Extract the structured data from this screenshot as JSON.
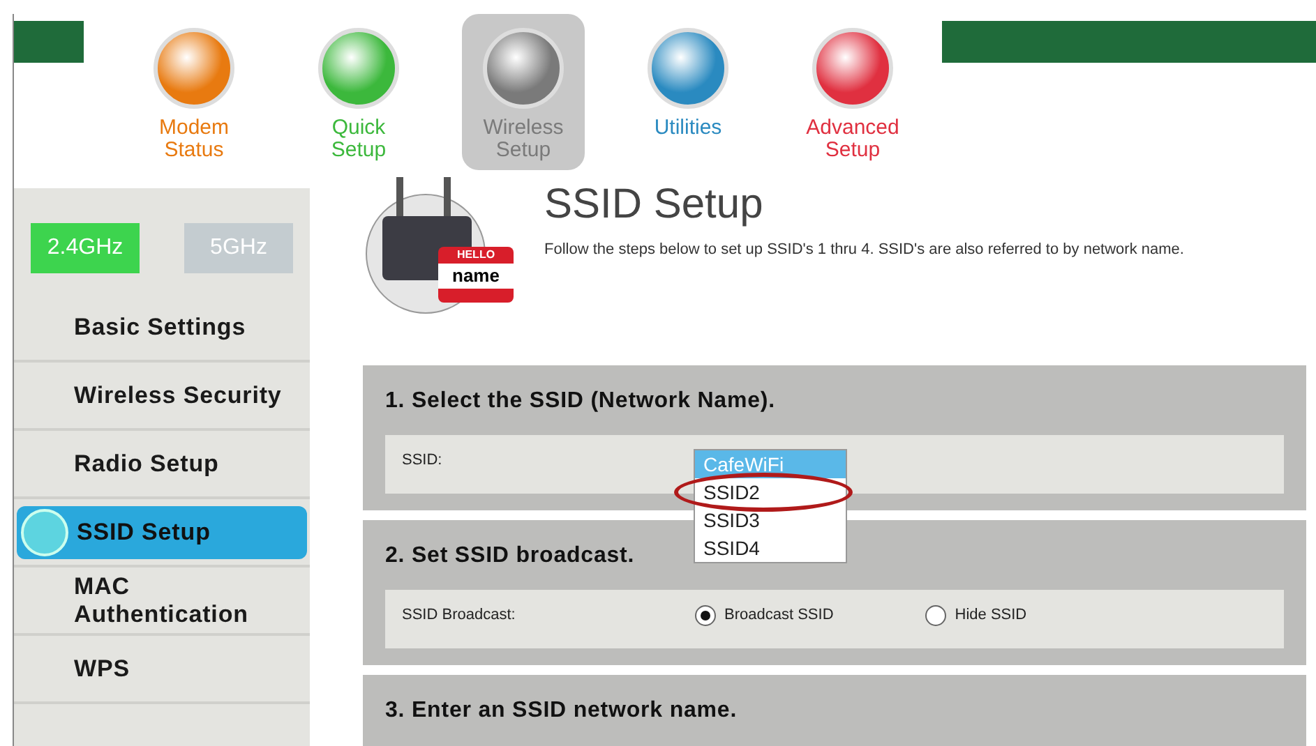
{
  "nav": [
    {
      "label": "Modem Status",
      "color": "#e87a10",
      "selected": false
    },
    {
      "label": "Quick Setup",
      "color": "#3cb83c",
      "selected": false
    },
    {
      "label": "Wireless Setup",
      "color": "#7a7a7a",
      "selected": true
    },
    {
      "label": "Utilities",
      "color": "#2a8ac0",
      "selected": false
    },
    {
      "label": "Advanced Setup",
      "color": "#e03040",
      "selected": false
    }
  ],
  "sidebar": {
    "bands": [
      {
        "label": "2.4GHz",
        "selected": true
      },
      {
        "label": "5GHz",
        "selected": false
      }
    ],
    "items": [
      {
        "label": "Basic Settings",
        "selected": false
      },
      {
        "label": "Wireless Security",
        "selected": false
      },
      {
        "label": "Radio Setup",
        "selected": false
      },
      {
        "label": "SSID Setup",
        "selected": true
      },
      {
        "label": "MAC Authentication",
        "selected": false
      },
      {
        "label": "WPS",
        "selected": false
      }
    ]
  },
  "header": {
    "title": "SSID Setup",
    "description": "Follow the steps below to set up SSID's 1 thru 4. SSID's are also referred to by network name.",
    "badge_top": "HELLO",
    "badge_bottom": "name"
  },
  "sections": [
    {
      "title": "1. Select the SSID (Network Name).",
      "kind": "select",
      "label": "SSID:",
      "options": [
        {
          "label": "CafeWiFi",
          "selected": true
        },
        {
          "label": "SSID2",
          "selected": false,
          "circled": true
        },
        {
          "label": "SSID3",
          "selected": false
        },
        {
          "label": "SSID4",
          "selected": false
        }
      ]
    },
    {
      "title": "2. Set SSID broadcast.",
      "kind": "radio",
      "label": "SSID Broadcast:",
      "options": [
        {
          "label": "Broadcast SSID",
          "selected": true
        },
        {
          "label": "Hide SSID",
          "selected": false
        }
      ]
    },
    {
      "title": "3. Enter an SSID network name.",
      "kind": "title"
    }
  ]
}
